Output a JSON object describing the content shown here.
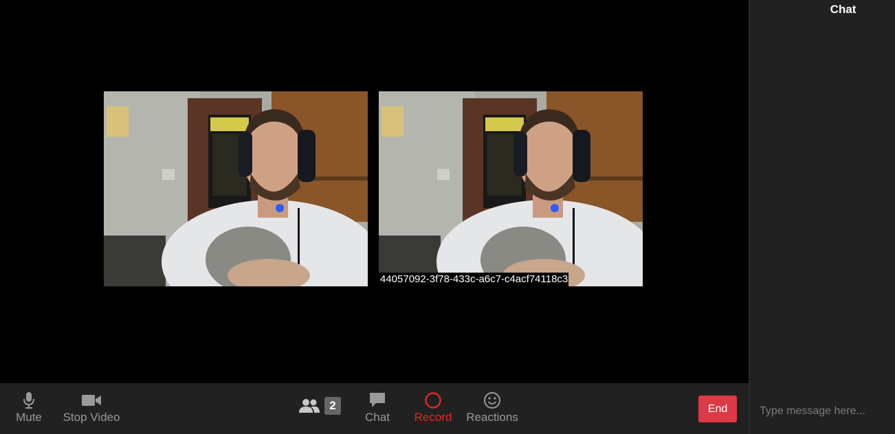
{
  "videos": [
    {
      "label": ""
    },
    {
      "label": "44057092-3f78-433c-a6c7-c4acf74118c3"
    }
  ],
  "toolbar": {
    "mute_label": "Mute",
    "stop_video_label": "Stop Video",
    "participant_count": "2",
    "chat_label": "Chat",
    "record_label": "Record",
    "reactions_label": "Reactions",
    "end_label": "End"
  },
  "chat": {
    "title": "Chat",
    "input_placeholder": "Type message here..."
  },
  "colors": {
    "toolbar_bg": "#212121",
    "end_button": "#dd3a47",
    "record": "#e02828"
  },
  "icons": [
    "microphone-icon",
    "video-camera-icon",
    "participants-icon",
    "chat-bubble-icon",
    "record-icon",
    "smiley-icon"
  ]
}
